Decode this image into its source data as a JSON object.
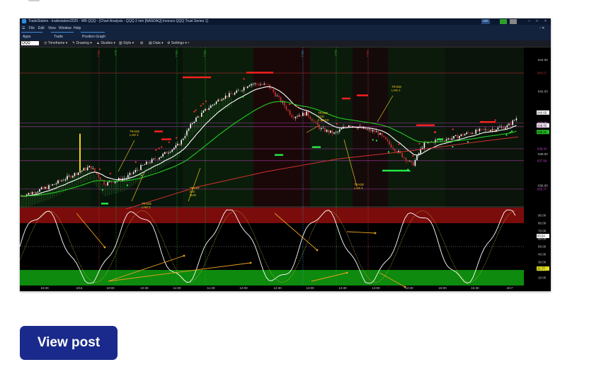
{
  "window": {
    "title": "TradeStation - tradestation2025 - WB QQQ - [Chart Analysis - QQQ 2 min [NASDAQ] Invesco QQQ Trust Series 1]",
    "account_badge": "ask",
    "menu": [
      "File",
      "Edit",
      "View",
      "Window",
      "Help"
    ],
    "submenu": [
      "Apps",
      "Trade",
      "Position Graph"
    ]
  },
  "toolbar": {
    "symbol": "QQQ",
    "items": [
      "Timeframe",
      "Drawing",
      "Studies",
      "Style",
      "Data",
      "Settings"
    ]
  },
  "chart_data": {
    "type": "candlestick",
    "title": "",
    "price_axis": {
      "ticks": [
        "644.00",
        "642.00",
        "640.00",
        "638.00",
        "636.00"
      ],
      "ylim": [
        634.5,
        644.8
      ]
    },
    "price_markers": [
      {
        "label": "643.17",
        "color": "#d03030"
      },
      {
        "label": "640.65",
        "color": "#ffffff"
      },
      {
        "label": "640.00",
        "color": "#cc44cc"
      },
      {
        "label": "639.83",
        "color": "#ffffff"
      },
      {
        "label": "639.75",
        "color": "#cc44cc"
      },
      {
        "label": "639.41",
        "color": "#22bb22"
      },
      {
        "label": "638.34",
        "color": "#cc44cc"
      },
      {
        "label": "637.58",
        "color": "#cc44cc"
      },
      {
        "label": "635.77",
        "color": "#cc44cc"
      }
    ],
    "oscillator_axis": {
      "ticks": [
        "90.00",
        "80.00",
        "70.00",
        "60.00",
        "50.00",
        "40.00",
        "30.00",
        "20.00",
        "10.00"
      ],
      "ylim": [
        0,
        100
      ]
    },
    "oscillator_markers": [
      {
        "label": "63.54",
        "color": "#ffffff"
      },
      {
        "label": "21.77",
        "color": "#dddd22"
      }
    ],
    "time_axis": [
      "15:30",
      "4/16",
      "10:00",
      "10:30",
      "11:00",
      "11:30",
      "12:00",
      "12:30",
      "13:00",
      "13:30",
      "14:00",
      "14:30",
      "15:00",
      "15:30",
      "4/17"
    ],
    "annotations": [
      {
        "lines": [
          "TRADE",
          "LAW 3"
        ],
        "color": "#e8c020"
      },
      {
        "lines": [
          "TRADE",
          "LAW 3"
        ],
        "color": "#e8c020"
      },
      {
        "lines": [
          "TRUST",
          "DGI",
          "MAR"
        ],
        "color": "#e8c020"
      },
      {
        "lines": [
          "TRADE",
          "SGD",
          "2 MACD"
        ],
        "color": "#e8c020"
      },
      {
        "lines": [
          "TRADE",
          "LAW 3"
        ],
        "color": "#e8c020"
      },
      {
        "lines": [
          "TRADE",
          "LAW 3"
        ],
        "color": "#e8c020"
      }
    ],
    "event_labels": [
      {
        "label": "SELL",
        "color": "#d03030"
      },
      {
        "label": "BUY",
        "color": "#22bb22"
      },
      {
        "label": "SELL",
        "color": "#22bb22"
      },
      {
        "label": "SELL",
        "color": "#22bb22"
      },
      {
        "label": "SELL",
        "color": "#3a9ad0"
      },
      {
        "label": "BUY",
        "color": "#22bb22"
      },
      {
        "label": "SELL",
        "color": "#d03030"
      }
    ],
    "colors": {
      "up": "#ffffff",
      "down": "#d03030",
      "ema_fast": "#ffffff",
      "ema_mid": "#22cc22",
      "ema_slow": "#d03030",
      "overbought": "#7a0c0c",
      "oversold": "#0e8a0e",
      "level_line": "#cc44cc",
      "arrow": "#e8a020"
    }
  },
  "post": {
    "button_label": "View post"
  }
}
